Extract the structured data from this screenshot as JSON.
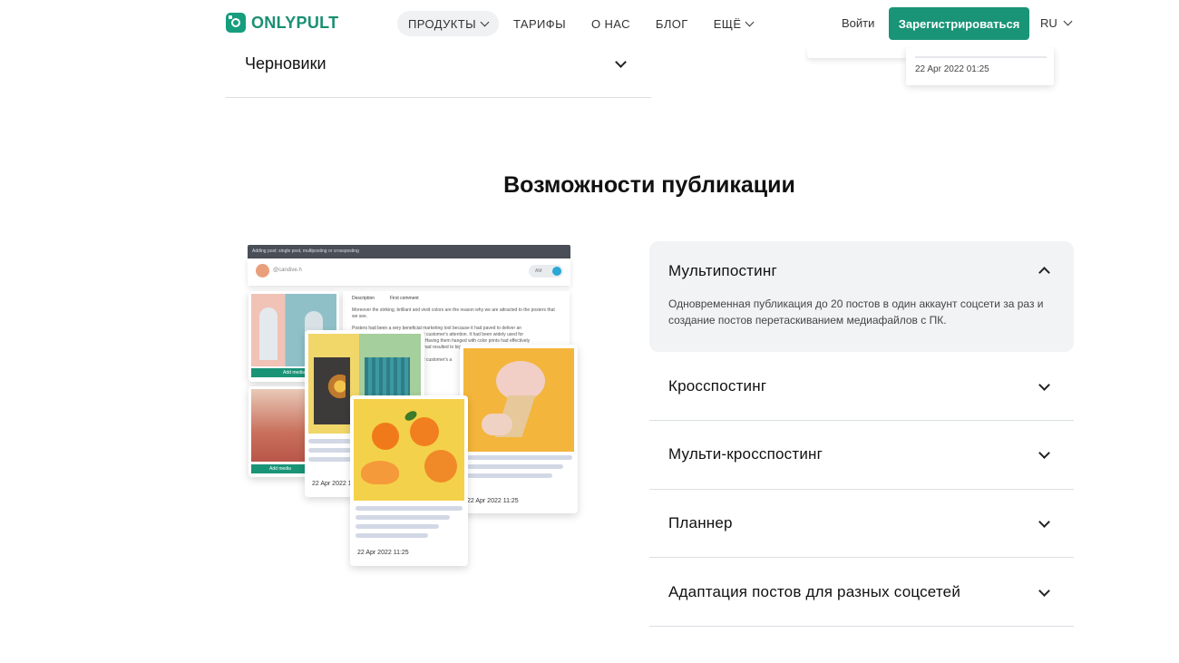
{
  "header": {
    "logo_text": "ONLYPULT",
    "nav": [
      {
        "label": "ПРОДУКТЫ",
        "has_dropdown": true,
        "active": true
      },
      {
        "label": "ТАРИФЫ",
        "has_dropdown": false
      },
      {
        "label": "О НАС",
        "has_dropdown": false
      },
      {
        "label": "БЛОГ",
        "has_dropdown": false
      },
      {
        "label": "ЕЩЁ",
        "has_dropdown": true
      }
    ],
    "login_label": "Войти",
    "register_label": "Зарегистрироваться",
    "lang_label": "RU"
  },
  "previous_section": {
    "drafts_label": "Черновики",
    "card_date": "22 Apr 2022  01:25"
  },
  "section": {
    "title": "Возможности публикации"
  },
  "illustration": {
    "bar_text": "Adding post: single post, multiposting or crossposting",
    "handle": "@candive.h",
    "pill": "AM",
    "tab_description": "Description",
    "tab_first_comment": "First comment",
    "editor_text_1": "Moreover the striking, brilliant and vivid colors are the reason why we are attracted to the posters that we see.",
    "editor_text_2": "Posters had been a very beneficial marketing tool because it had paved to deliver an",
    "editor_text_3": "ed customer's attention. It had been widely used for",
    "editor_text_4": "e. Having them hanged with color prints had effectively",
    "editor_text_5": "It had resulted to bigger and",
    "editor_text_6": "ed customer's a",
    "add_media": "Add media",
    "date_1": "22 Apr 2022  11:25",
    "date_2": "22 Apr 2022  11:25",
    "date_3": "22 Apr 2022  11:25"
  },
  "accordion": [
    {
      "title": "Мультипостинг",
      "open": true,
      "body": "Одновременная публикация до 20 постов в один аккаунт соцсети за раз и создание постов перетаскиванием медиафайлов с ПК."
    },
    {
      "title": "Кросспостинг",
      "open": false
    },
    {
      "title": "Мульти-кросспостинг",
      "open": false
    },
    {
      "title": "Планнер",
      "open": false
    },
    {
      "title": "Адаптация постов для разных соцсетей",
      "open": false
    }
  ],
  "colors": {
    "brand": "#1a9477",
    "accordion_open_bg": "#f2f3f5",
    "divider": "#dcdfe3"
  }
}
